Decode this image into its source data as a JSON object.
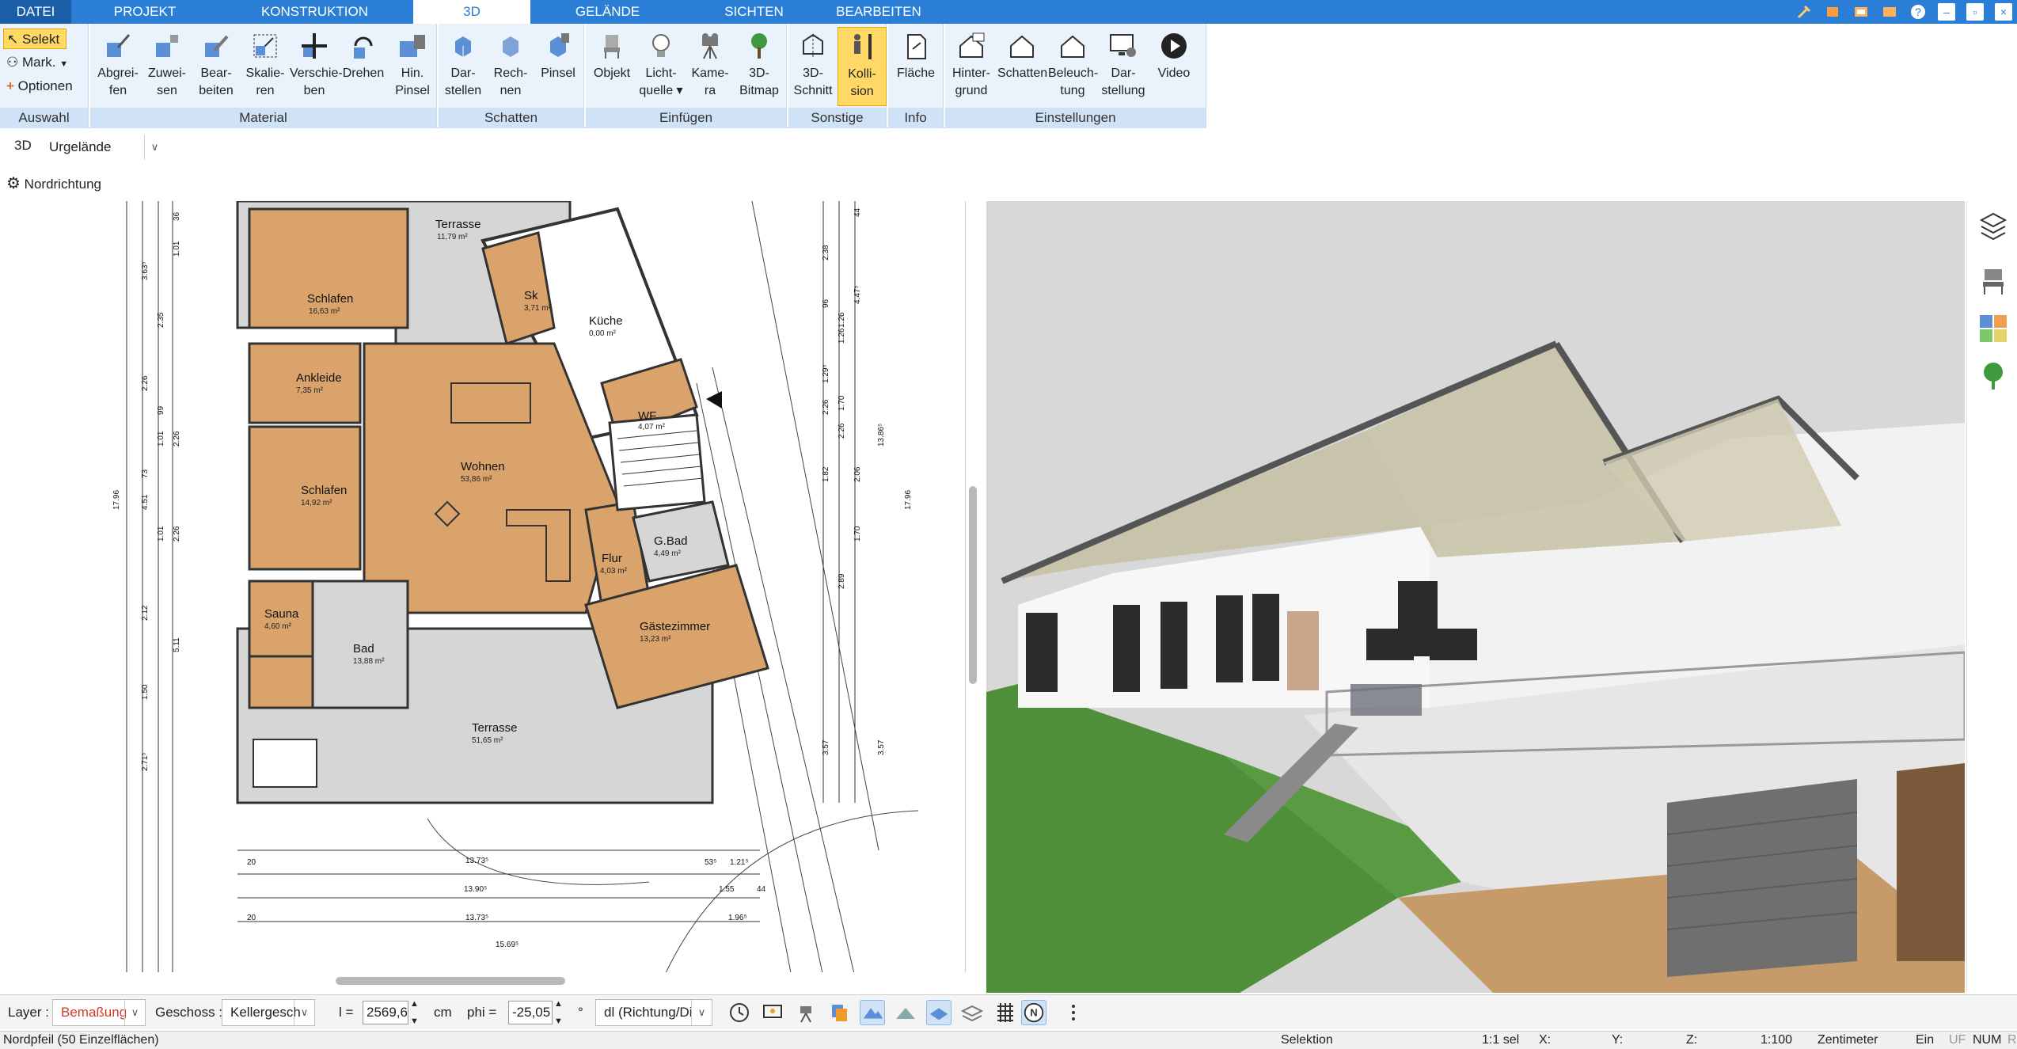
{
  "tabs": [
    {
      "label": "DATEI"
    },
    {
      "label": "PROJEKT"
    },
    {
      "label": "KONSTRUKTION"
    },
    {
      "label": "3D"
    },
    {
      "label": "GELÄNDE"
    },
    {
      "label": "SICHTEN"
    },
    {
      "label": "BEARBEITEN"
    }
  ],
  "active_tab": "3D",
  "ribbon": {
    "auswahl": {
      "title": "Auswahl",
      "items": [
        "Selekt",
        "Mark.",
        "Optionen"
      ]
    },
    "material": {
      "title": "Material",
      "buttons": [
        "Abgrei-\nfen",
        "Zuwei-\nsen",
        "Bear-\nbeiten",
        "Skalie-\nren",
        "Verschie-\nben",
        "Drehen",
        "Hin.\nPinsel"
      ]
    },
    "schatten": {
      "title": "Schatten",
      "buttons": [
        "Dar-\nstellen",
        "Rech-\nnen",
        "Pinsel"
      ]
    },
    "einfuegen": {
      "title": "Einfügen",
      "buttons": [
        "Objekt",
        "Licht-\nquelle ▾",
        "Kame-\nra",
        "3D-\nBitmap"
      ]
    },
    "sonstige": {
      "title": "Sonstige",
      "buttons": [
        "3D-\nSchnitt",
        "Kolli-\nsion"
      ]
    },
    "info": {
      "title": "Info",
      "buttons": [
        "Fläche"
      ]
    },
    "einstellungen": {
      "title": "Einstellungen",
      "buttons": [
        "Hinter-\ngrund",
        "Schatten",
        "Beleuch-\ntung",
        "Dar-\nstellung",
        "Video"
      ]
    }
  },
  "toolbar": {
    "mode_label": "3D",
    "terrain_select": "Urgelände",
    "north_label": "Nordrichtung"
  },
  "plan": {
    "rooms": [
      {
        "name": "Terrasse",
        "area": "11,79 m²"
      },
      {
        "name": "Sk",
        "area": "3,71 m²"
      },
      {
        "name": "Küche",
        "area": "0,00 m²"
      },
      {
        "name": "Schlafen",
        "area": "16,63 m²"
      },
      {
        "name": "Ankleide",
        "area": "7,35 m²"
      },
      {
        "name": "WF",
        "area": "4,07 m²"
      },
      {
        "name": "Wohnen",
        "area": "53,86 m²"
      },
      {
        "name": "Schlafen",
        "area": "14,92 m²"
      },
      {
        "name": "Flur",
        "area": "4,03 m²"
      },
      {
        "name": "G.Bad",
        "area": "4,49 m²"
      },
      {
        "name": "Sauna",
        "area": "4,60 m²"
      },
      {
        "name": "Gästezimmer",
        "area": "13,23 m²"
      },
      {
        "name": "Bad",
        "area": "13,88 m²"
      },
      {
        "name": "Terrasse",
        "area": "51,65 m²"
      }
    ],
    "dims_bottom": [
      "13.73⁵",
      "13.90⁵",
      "13.73⁵",
      "15.69⁵",
      "1.96⁵",
      "1.55",
      "44",
      "53⁵",
      "1.21⁵",
      "20",
      "20"
    ],
    "dims_left": [
      "17.96",
      "3.63⁵",
      "2.35",
      "2.26",
      "99",
      "1.01",
      "2.26",
      "73",
      "4.51",
      "1.01",
      "2.26",
      "2.12",
      "5.11",
      "1.50",
      "2.71⁵",
      "36",
      "1.01"
    ],
    "dims_right": [
      "44",
      "2.38",
      "4.47⁵",
      "96",
      "1.26",
      "1.29⁵",
      "1.70",
      "13.86⁵",
      "2.26",
      "1.82",
      "2.06",
      "17.96",
      "1.70",
      "2.89",
      "3.57",
      "3.57",
      "1.26",
      "2.26"
    ]
  },
  "bottombar": {
    "layer_label": "Layer :",
    "layer_value": "Bemaßung",
    "geschoss_label": "Geschoss :",
    "geschoss_value": "Kellergesch",
    "l_label": "l =",
    "l_value": "2569,6",
    "l_unit": "cm",
    "phi_label": "phi =",
    "phi_value": "-25,05",
    "phi_unit": "°",
    "dl_value": "dl (Richtung/Di"
  },
  "statusbar": {
    "left": "Nordpfeil (50 Einzelflächen)",
    "mode": "Selektion",
    "sel": "1:1 sel",
    "x": "X:",
    "y": "Y:",
    "z": "Z:",
    "scale": "1:100",
    "unit": "Zentimeter",
    "ein": "Ein",
    "uf": "UF",
    "num": "NUM",
    "ri": "RI"
  },
  "colors": {
    "accent": "#2a7ed6",
    "wood": "#d9a36b",
    "ribbon_bg": "#eaf2fb",
    "active_btn": "#ffd866"
  }
}
